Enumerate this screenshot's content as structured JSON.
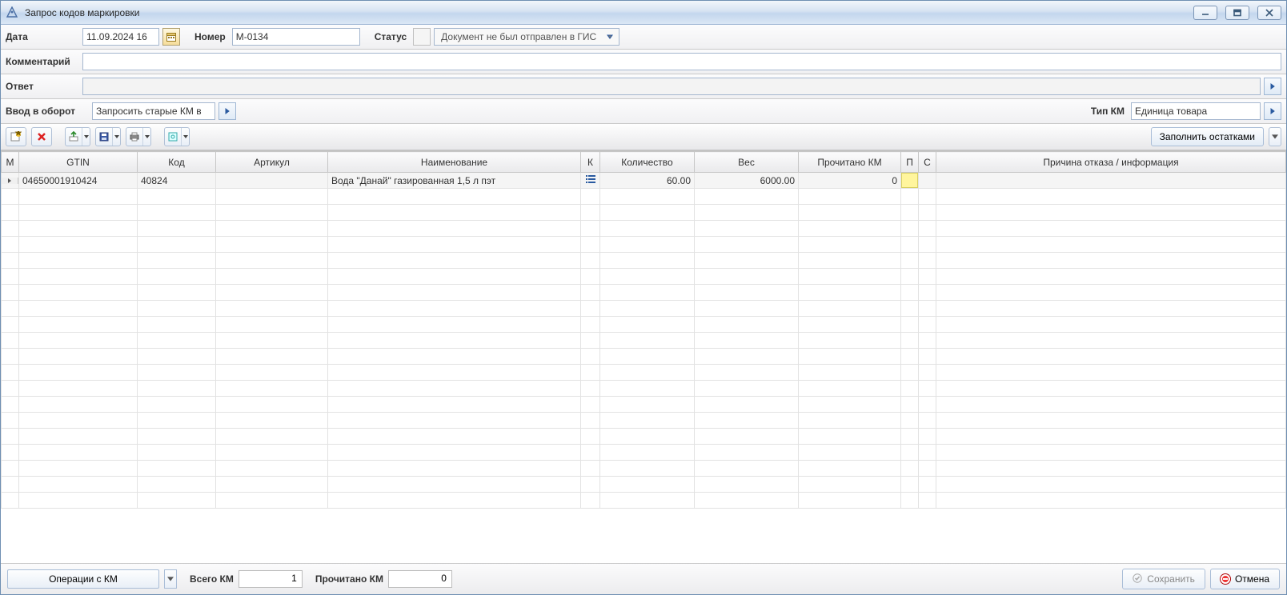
{
  "window": {
    "title": "Запрос кодов маркировки"
  },
  "header": {
    "date_label": "Дата",
    "date_value": "11.09.2024 16",
    "number_label": "Номер",
    "number_value": "М-0134",
    "status_label": "Статус",
    "status_value": "Документ не был отправлен в ГИС",
    "comment_label": "Комментарий",
    "comment_value": "",
    "answer_label": "Ответ",
    "answer_value": ""
  },
  "actionsRow": {
    "vvod_label": "Ввод в оборот",
    "request_old_label": "Запросить старые КМ в",
    "type_km_label": "Тип КМ",
    "type_km_value": "Единица товара"
  },
  "toolbar": {
    "fill_remains_label": "Заполнить остатками"
  },
  "grid": {
    "columns": {
      "m": "М",
      "gtin": "GTIN",
      "code": "Код",
      "article": "Артикул",
      "name": "Наименование",
      "k": "К",
      "qty": "Количество",
      "weight": "Вес",
      "read_km": "Прочитано КМ",
      "p": "П",
      "s": "С",
      "reason": "Причина отказа / информация"
    },
    "rows": [
      {
        "gtin": "04650001910424",
        "code": "40824",
        "article": "",
        "name": "Вода \"Данай\" газированная 1,5 л пэт",
        "qty": "60.00",
        "weight": "6000.00",
        "read_km": "0",
        "reason": ""
      }
    ]
  },
  "footer": {
    "ops_label": "Операции с  КМ",
    "total_km_label": "Всего КМ",
    "total_km_value": "1",
    "read_km_label": "Прочитано КМ",
    "read_km_value": "0",
    "save_label": "Сохранить",
    "cancel_label": "Отмена"
  }
}
